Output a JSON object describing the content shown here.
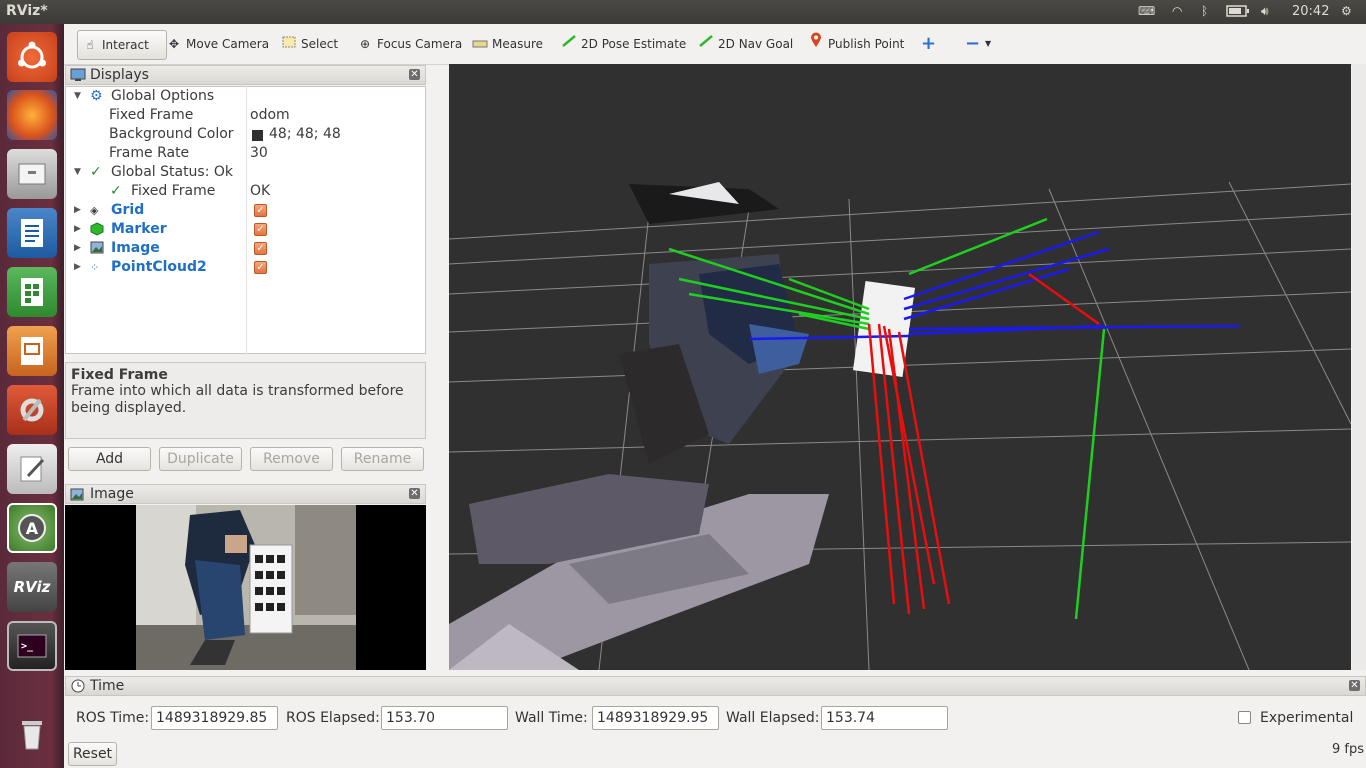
{
  "window": {
    "title": "RViz*"
  },
  "system_tray": {
    "clock": "20:42",
    "keyboard_icon": "keyboard-icon",
    "wifi_icon": "wifi-icon",
    "bluetooth_icon": "bluetooth-icon",
    "battery_icon": "battery-icon",
    "volume_icon": "volume-icon",
    "settings_icon": "gear-icon"
  },
  "launcher": {
    "rviz_label": "RViz"
  },
  "toolbar": {
    "interact": "Interact",
    "move_camera": "Move Camera",
    "select": "Select",
    "focus_camera": "Focus Camera",
    "measure": "Measure",
    "pose_estimate": "2D Pose Estimate",
    "nav_goal": "2D Nav Goal",
    "publish_point": "Publish Point",
    "add_tool": "+",
    "remove_tool": "−"
  },
  "displays": {
    "title": "Displays",
    "global_options": "Global Options",
    "fixed_frame_label": "Fixed Frame",
    "fixed_frame_value": "odom",
    "bg_color_label": "Background Color",
    "bg_color_value": "48; 48; 48",
    "bg_color_hex": "#303030",
    "frame_rate_label": "Frame Rate",
    "frame_rate_value": "30",
    "global_status": "Global Status: Ok",
    "status_fixed_frame": "Fixed Frame",
    "status_fixed_frame_value": "OK",
    "items": [
      {
        "label": "Grid",
        "checked": true
      },
      {
        "label": "Marker",
        "checked": true
      },
      {
        "label": "Image",
        "checked": true
      },
      {
        "label": "PointCloud2",
        "checked": true
      }
    ]
  },
  "description": {
    "title": "Fixed Frame",
    "text": "Frame into which all data is transformed before being displayed."
  },
  "buttons": {
    "add": "Add",
    "duplicate": "Duplicate",
    "remove": "Remove",
    "rename": "Rename",
    "reset": "Reset"
  },
  "image_panel": {
    "title": "Image"
  },
  "time": {
    "title": "Time",
    "ros_time_label": "ROS Time:",
    "ros_time": "1489318929.85",
    "ros_elapsed_label": "ROS Elapsed:",
    "ros_elapsed": "153.70",
    "wall_time_label": "Wall Time:",
    "wall_time": "1489318929.95",
    "wall_elapsed_label": "Wall Elapsed:",
    "wall_elapsed": "153.74",
    "experimental": "Experimental",
    "fps": "9 fps"
  }
}
